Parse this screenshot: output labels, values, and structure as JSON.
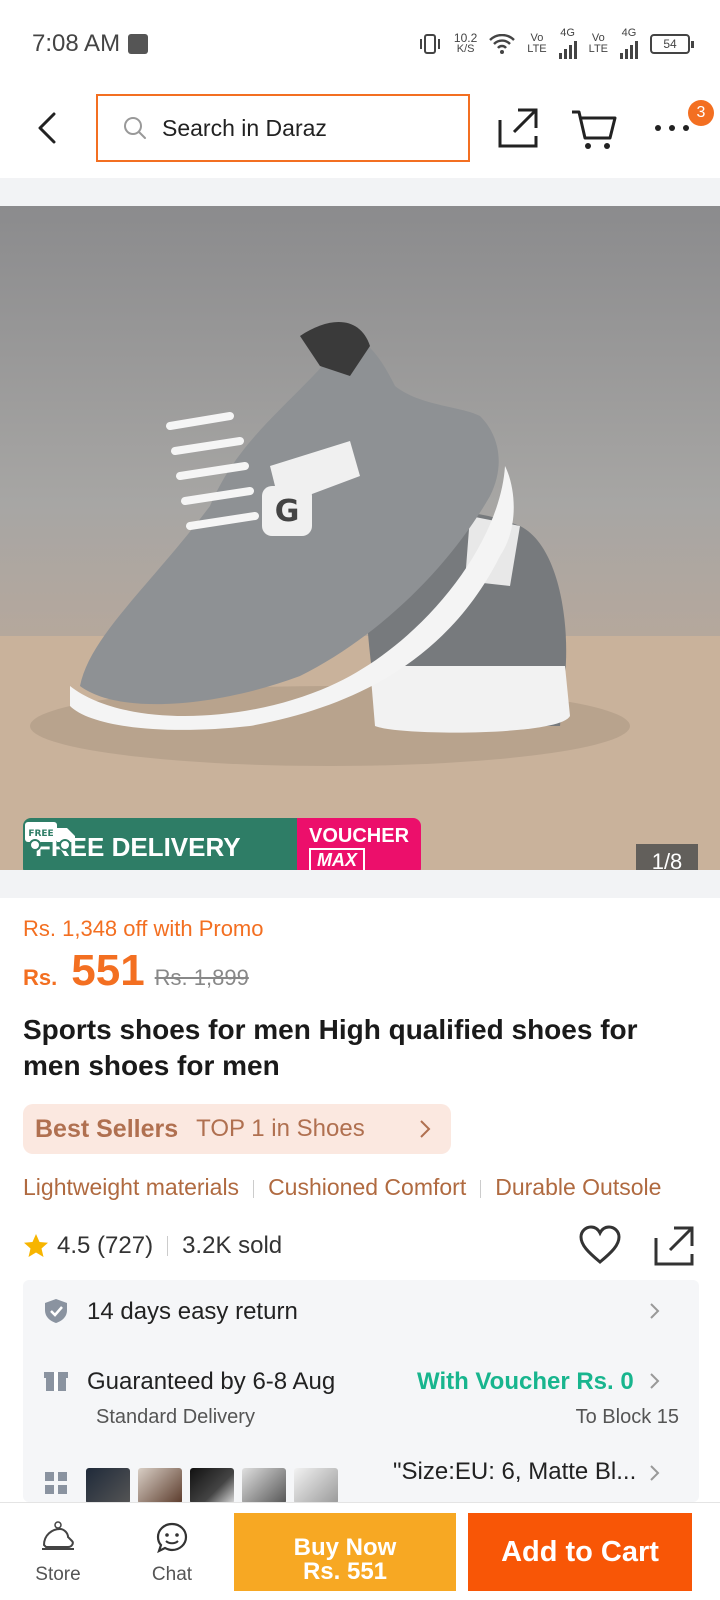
{
  "status_bar": {
    "time": "7:08 AM",
    "speed": "10.2",
    "speed_unit": "K/S",
    "net1": "Vo\nLTE",
    "net1_gen": "4G",
    "net2": "Vo\nLTE",
    "net2_gen": "4G",
    "battery": "54"
  },
  "header": {
    "search_placeholder": "Search in Daraz",
    "more_badge": "3"
  },
  "gallery": {
    "free_delivery": "FREE DELIVERY",
    "free_tag": "FREE",
    "voucher_top": "VOUCHER",
    "voucher_max": "MAX",
    "counter": "1/8"
  },
  "product": {
    "promo": "Rs. 1,348 off with Promo",
    "currency": "Rs.",
    "price": "551",
    "old_price": "Rs. 1,899",
    "title": "Sports shoes for men High qualified shoes for men shoes for men",
    "best_sellers_label": "Best Sellers",
    "best_sellers_rank": "TOP 1 in Shoes",
    "features": [
      "Lightweight materials",
      "Cushioned Comfort",
      "Durable Outsole"
    ],
    "rating": "4.5",
    "reviews": "(727)",
    "sold": "3.2K sold"
  },
  "service": {
    "return": "14 days easy return",
    "delivery": "Guaranteed by 6-8 Aug",
    "delivery_type": "Standard Delivery",
    "voucher": "With Voucher Rs. 0",
    "destination": "To Block 15",
    "variant": "\"Size:EU: 6, Matte Bl..."
  },
  "bottom_bar": {
    "store": "Store",
    "chat": "Chat",
    "buy_now": "Buy Now",
    "buy_price": "Rs. 551",
    "add_to_cart": "Add to Cart"
  },
  "colors": {
    "accent": "#f85606",
    "search_border": "#f36f21",
    "buy_now": "#f7a823",
    "green": "#18b58e",
    "free_delivery": "#2e7d66",
    "voucher": "#ec0f6b"
  }
}
